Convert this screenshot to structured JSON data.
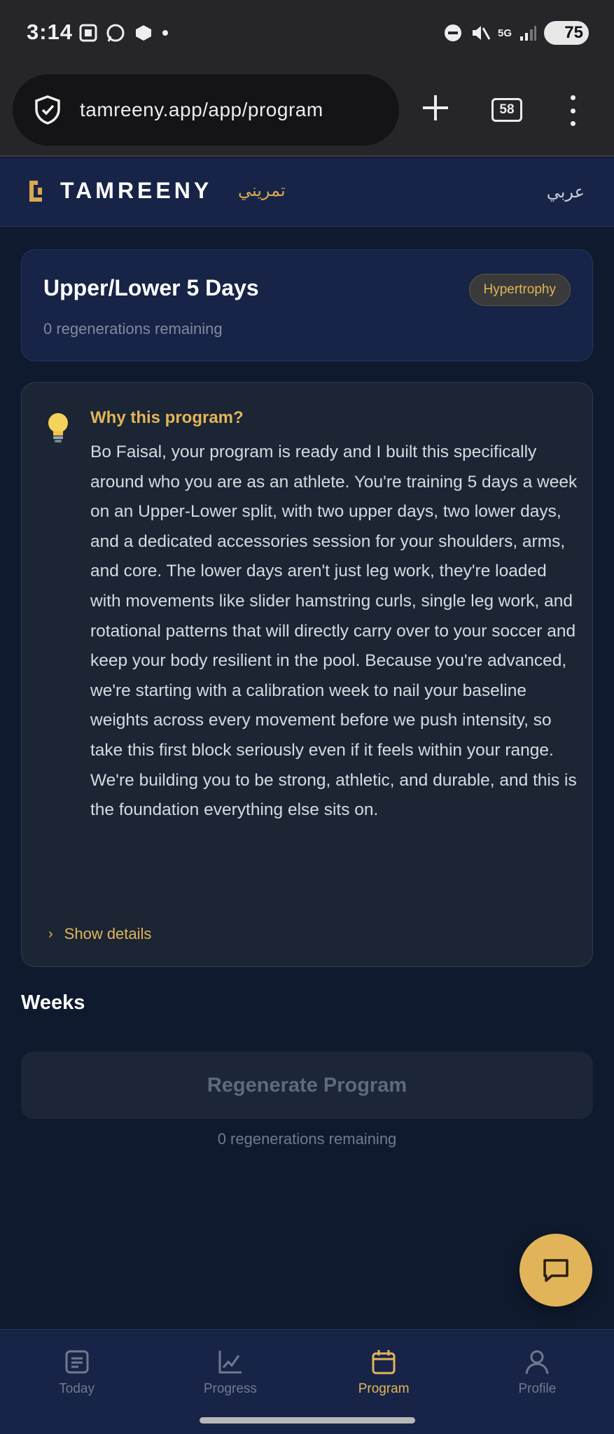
{
  "status_bar": {
    "time": "3:14",
    "network": "5G",
    "battery": "75"
  },
  "browser": {
    "url": "tamreeny.app/app/program",
    "tab_count": "58"
  },
  "header": {
    "brand": "TAMREENY",
    "brand_arabic": "تمريني",
    "language_toggle": "عربي"
  },
  "program": {
    "title": "Upper/Lower 5 Days",
    "badge": "Hypertrophy",
    "regenerations_text": "0 regenerations remaining"
  },
  "why": {
    "heading": "Why this program?",
    "body": "Bo Faisal, your program is ready and I built this specifically around who you are as an athlete. You're training 5 days a week on an Upper-Lower split, with two upper days, two lower days, and a dedicated accessories session for your shoulders, arms, and core. The lower days aren't just leg work, they're loaded with movements like slider hamstring curls, single leg work, and rotational patterns that will directly carry over to your soccer and keep your body resilient in the pool. Because you're advanced, we're starting with a calibration week to nail your baseline weights across every movement before we push intensity, so take this first block seriously even if it feels within your range. We're building you to be strong, athletic, and durable, and this is the foundation everything else sits on.",
    "show_details": "Show details"
  },
  "weeks": {
    "heading": "Weeks"
  },
  "regenerate": {
    "button_label": "Regenerate Program",
    "remaining_text": "0 regenerations remaining"
  },
  "nav": {
    "items": [
      {
        "label": "Today",
        "icon": "calendar-list-icon"
      },
      {
        "label": "Progress",
        "icon": "chart-icon"
      },
      {
        "label": "Program",
        "icon": "calendar-icon"
      },
      {
        "label": "Profile",
        "icon": "user-icon"
      }
    ],
    "active": "Program"
  },
  "colors": {
    "background": "#0f1a2e",
    "accent": "#e2b45a",
    "card": "#172447"
  }
}
